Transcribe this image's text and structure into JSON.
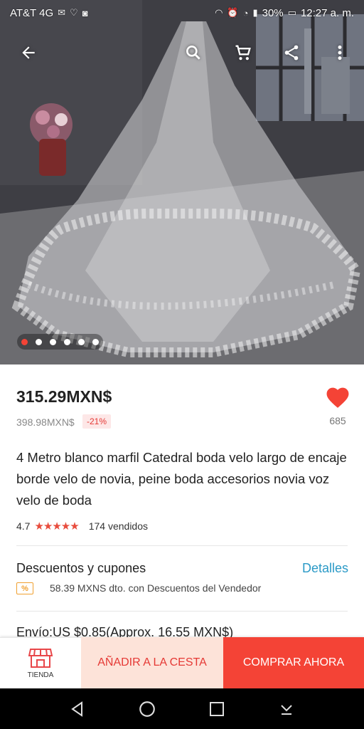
{
  "status_bar": {
    "carrier": "AT&T 4G",
    "battery": "30%",
    "time": "12:27 a. m."
  },
  "gallery": {
    "image_count": 6,
    "active_index": 0
  },
  "product": {
    "price": "315.29MXN$",
    "original_price": "398.98MXN$",
    "discount": "-21%",
    "likes": "685",
    "title": "4 Metro blanco marfil Catedral boda velo largo de encaje borde velo de novia, peine boda accesorios novia voz velo de boda",
    "rating": "4.7",
    "sold": "174 vendidos"
  },
  "coupons": {
    "title": "Descuentos y cupones",
    "link": "Detalles",
    "badge": "%",
    "text": "58.39 MXNS dto. con Descuentos del Vendedor"
  },
  "shipping": {
    "text": "Envío:US $0.85(Approx. 16.55 MXN$)"
  },
  "actions": {
    "store_label": "TIENDA",
    "add_to_cart": "AÑADIR A LA CESTA",
    "buy_now": "COMPRAR AHORA"
  },
  "colors": {
    "accent_red": "#f44336",
    "link_blue": "#2b9ac7",
    "add_cart_bg": "#fde3d9"
  }
}
